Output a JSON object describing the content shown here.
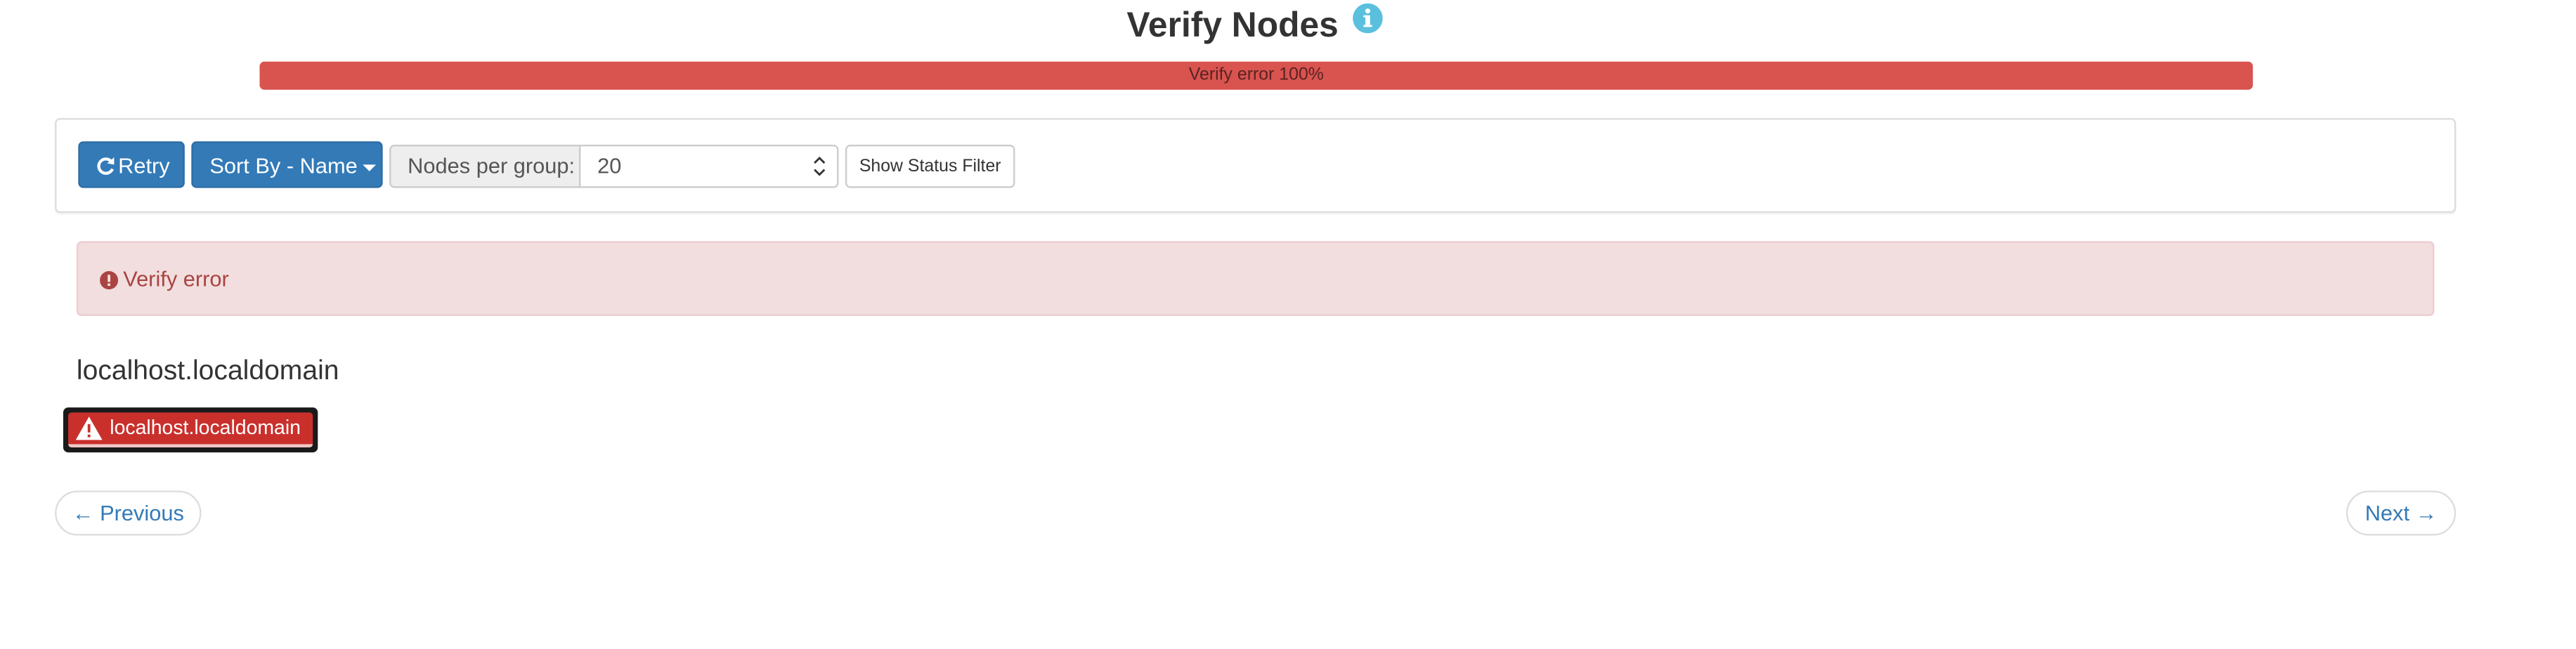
{
  "header": {
    "title": "Verify Nodes",
    "info_icon": "info-circle-icon"
  },
  "progress": {
    "label": "Verify error 100%",
    "percent": 100,
    "color": "#d9534f"
  },
  "toolbar": {
    "retry_label": "Retry",
    "retry_icon": "refresh-icon",
    "sort_label": "Sort By - Name",
    "nodes_per_group_label": "Nodes per group:",
    "nodes_per_group_value": "20",
    "status_filter_label": "Show Status Filter"
  },
  "alert": {
    "icon": "exclamation-circle-icon",
    "message": "Verify error"
  },
  "group": {
    "heading": "localhost.localdomain",
    "nodes": [
      {
        "label": "localhost.localdomain",
        "icon": "warning-triangle-icon",
        "status": "error"
      }
    ]
  },
  "pager": {
    "previous_label": "← Previous",
    "next_label": "Next →"
  },
  "colors": {
    "primary": "#337ab7",
    "danger": "#d9534f",
    "alert_bg": "#f2dede",
    "alert_text": "#a94442",
    "info": "#5bc0de"
  }
}
